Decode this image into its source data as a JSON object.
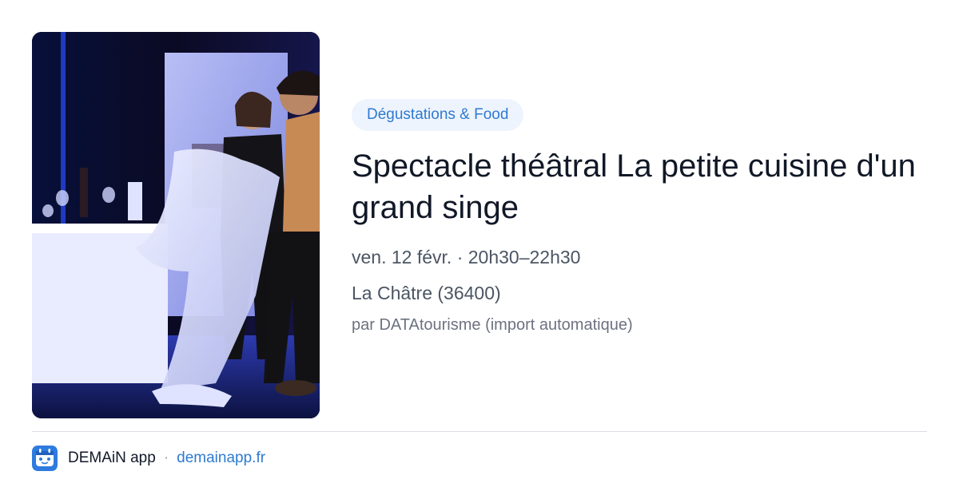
{
  "event": {
    "category": "Dégustations & Food",
    "title": "Spectacle théâtral La petite cuisine d'un grand singe",
    "datetime": "ven. 12 févr. · 20h30–22h30",
    "location": "La Châtre (36400)",
    "source": "par DATAtourisme (import automatique)",
    "image_alt": "Deux comédiens sur scène dépliant une grande nappe blanche"
  },
  "footer": {
    "app_name": "DEMAiN app",
    "separator": "·",
    "link": "demainapp.fr",
    "icon": "demain-app-icon"
  },
  "colors": {
    "accent": "#2f7ad1",
    "pill_bg": "#eef4fd",
    "title": "#111827",
    "meta": "#4b5563",
    "source": "#6b7280",
    "divider": "#d9dee5"
  }
}
